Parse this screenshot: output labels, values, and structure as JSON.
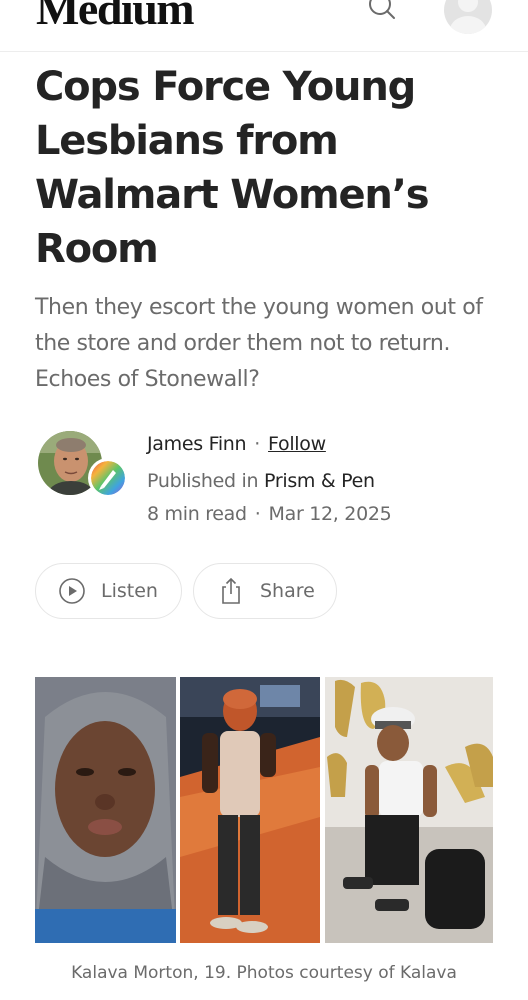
{
  "header": {
    "logo": "Medium",
    "search_icon": "search-icon",
    "avatar_icon": "user-avatar-icon"
  },
  "article": {
    "title_lines": [
      "Cops Force Young",
      "Lesbians from",
      "Walmart Women’s",
      "Room"
    ],
    "subtitle": "Then they escort the young women out of the store and order them not to return. Echoes of Stonewall?"
  },
  "author": {
    "name": "James Finn",
    "separator": "·",
    "follow_label": "Follow",
    "published_in_label": "Published in",
    "publication": "Prism & Pen",
    "read_time": "8 min read",
    "date": "Mar 12, 2025"
  },
  "actions": {
    "listen_label": "Listen",
    "share_label": "Share"
  },
  "media": {
    "caption": "Kalava Morton, 19. Photos courtesy of Kalava"
  },
  "colors": {
    "text": "#242424",
    "muted": "#6b6b6b",
    "border": "#e6e6e6"
  }
}
